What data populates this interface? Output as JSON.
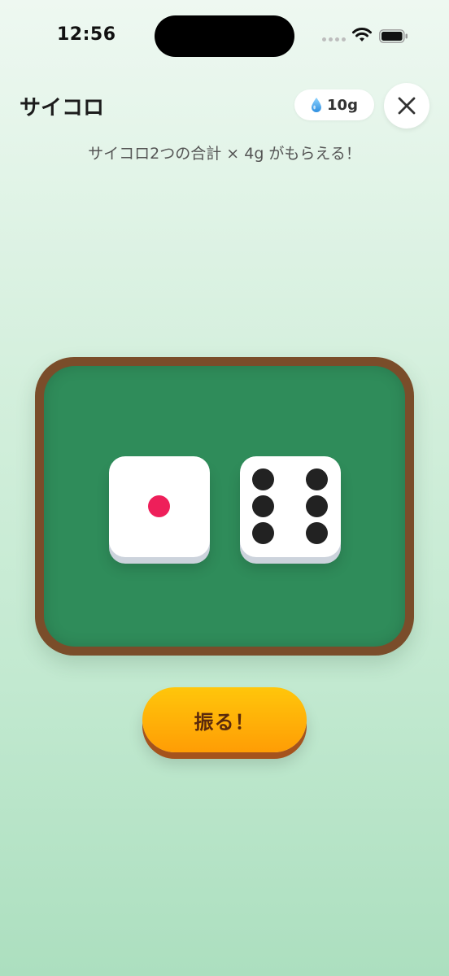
{
  "status_bar": {
    "time": "12:56"
  },
  "header": {
    "title": "サイコロ",
    "balance": "10g",
    "balance_icon": "water-drop-icon",
    "close_icon": "close-icon"
  },
  "subtitle": "サイコロ2つの合計 × 4g がもらえる！",
  "dice": {
    "die1_value": 1,
    "die2_value": 6
  },
  "roll_button": {
    "label": "振る！"
  },
  "colors": {
    "felt": "#2f8c5a",
    "frame": "#7a4d2a",
    "button": "#ffb20a",
    "pip_one": "#ee1f5a",
    "pip": "#222222"
  }
}
